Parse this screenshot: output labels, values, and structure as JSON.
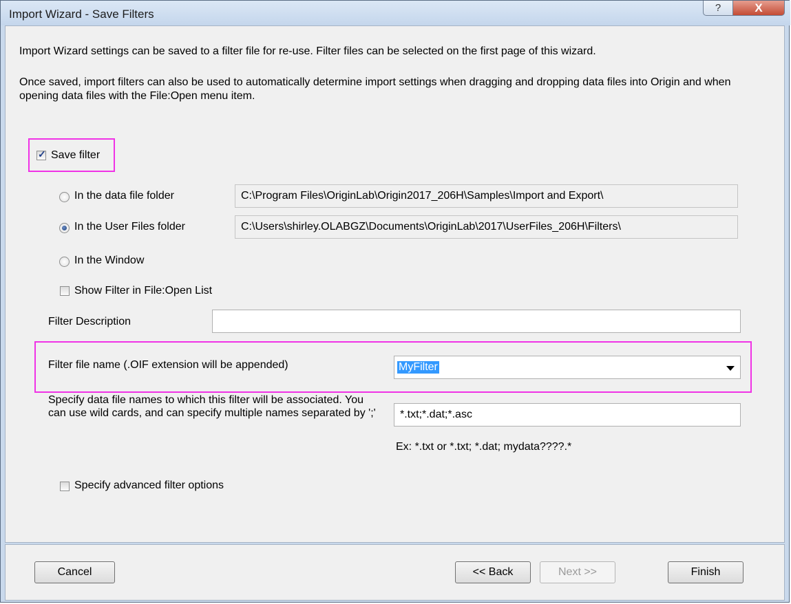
{
  "window": {
    "title": "Import Wizard - Save Filters",
    "help_glyph": "?",
    "close_glyph": "X"
  },
  "intro": {
    "line1": "Import Wizard settings can be saved to a filter file for re-use. Filter files can be selected on the first page of this wizard.",
    "line2": "Once saved, import filters can also be used to automatically determine import settings when dragging and dropping data files into Origin and when opening data files with the File:Open menu item."
  },
  "save_filter": {
    "label": "Save filter",
    "checked": true
  },
  "locations": [
    {
      "label": "In the data file folder",
      "path": "C:\\Program Files\\OriginLab\\Origin2017_206H\\Samples\\Import and Export\\",
      "selected": false
    },
    {
      "label": "In the User Files folder",
      "path": "C:\\Users\\shirley.OLABGZ\\Documents\\OriginLab\\2017\\UserFiles_206H\\Filters\\",
      "selected": true
    },
    {
      "label": "In the Window",
      "selected": false
    }
  ],
  "show_in_open_list": {
    "label": "Show Filter in File:Open List",
    "checked": false
  },
  "filter_description": {
    "label": "Filter Description",
    "value": ""
  },
  "filter_file_name": {
    "label": "Filter file name (.OIF extension will be appended)",
    "value": "MyFilter"
  },
  "associations": {
    "label": "Specify data file names to which this filter will be associated.  You can use wild cards, and can specify multiple names separated by ';'",
    "value": "*.txt;*.dat;*.asc",
    "example": "Ex: *.txt or *.txt; *.dat; mydata????.*"
  },
  "advanced": {
    "label": "Specify advanced filter options",
    "checked": false
  },
  "buttons": {
    "cancel": "Cancel",
    "back": "<< Back",
    "next": "Next >>",
    "finish": "Finish"
  }
}
